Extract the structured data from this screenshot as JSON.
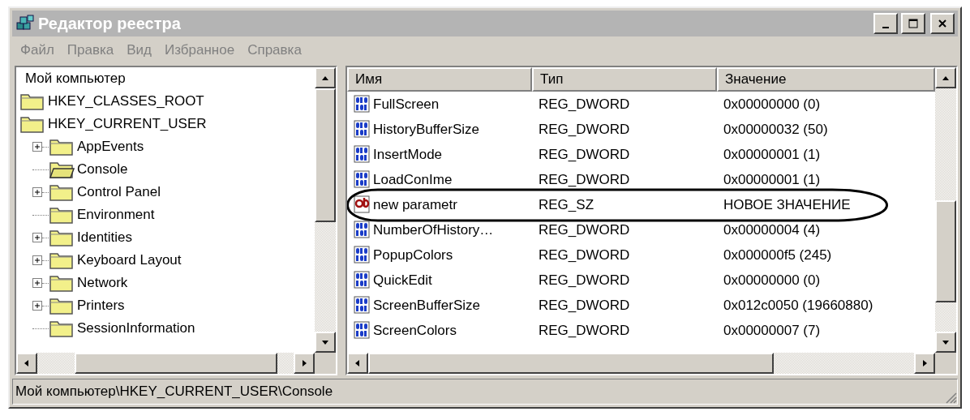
{
  "window": {
    "title": "Редактор реестра"
  },
  "menu": [
    "Файл",
    "Правка",
    "Вид",
    "Избранное",
    "Справка"
  ],
  "tree": {
    "label": "Мой компьютер",
    "selected": false,
    "children": [
      {
        "label": "HKEY_CLASSES_ROOT",
        "selected": false
      },
      {
        "label": "HKEY_CURRENT_USER",
        "selected": false,
        "children": [
          {
            "label": "AppEvents",
            "expandable": true,
            "selected": false
          },
          {
            "label": "Console",
            "expandable": false,
            "selected": true
          },
          {
            "label": "Control Panel",
            "expandable": true,
            "selected": false
          },
          {
            "label": "Environment",
            "expandable": false,
            "selected": false
          },
          {
            "label": "Identities",
            "expandable": true,
            "selected": false
          },
          {
            "label": "Keyboard Layout",
            "expandable": true,
            "selected": false
          },
          {
            "label": "Network",
            "expandable": true,
            "selected": false
          },
          {
            "label": "Printers",
            "expandable": true,
            "selected": false
          },
          {
            "label": "SessionInformation",
            "expandable": false,
            "selected": false
          }
        ]
      }
    ]
  },
  "list": {
    "columns": [
      "Имя",
      "Тип",
      "Значение"
    ],
    "rows": [
      {
        "kind": "dword",
        "name": "FullScreen",
        "type": "REG_DWORD",
        "value": "0x00000000 (0)",
        "circled": false
      },
      {
        "kind": "dword",
        "name": "HistoryBufferSize",
        "type": "REG_DWORD",
        "value": "0x00000032 (50)",
        "circled": false
      },
      {
        "kind": "dword",
        "name": "InsertMode",
        "type": "REG_DWORD",
        "value": "0x00000001 (1)",
        "circled": false
      },
      {
        "kind": "dword",
        "name": "LoadConIme",
        "type": "REG_DWORD",
        "value": "0x00000001 (1)",
        "circled": false
      },
      {
        "kind": "string",
        "name": "new parametr",
        "type": "REG_SZ",
        "value": "НОВОЕ ЗНАЧЕНИЕ",
        "circled": true
      },
      {
        "kind": "dword",
        "name": "NumberOfHistory…",
        "type": "REG_DWORD",
        "value": "0x00000004 (4)",
        "circled": false
      },
      {
        "kind": "dword",
        "name": "PopupColors",
        "type": "REG_DWORD",
        "value": "0x000000f5 (245)",
        "circled": false
      },
      {
        "kind": "dword",
        "name": "QuickEdit",
        "type": "REG_DWORD",
        "value": "0x00000000 (0)",
        "circled": false
      },
      {
        "kind": "dword",
        "name": "ScreenBufferSize",
        "type": "REG_DWORD",
        "value": "0x012c0050 (19660880)",
        "circled": false
      },
      {
        "kind": "dword",
        "name": "ScreenColors",
        "type": "REG_DWORD",
        "value": "0x00000007 (7)",
        "circled": false
      }
    ]
  },
  "status_bar": "Мой компьютер\\HKEY_CURRENT_USER\\Console"
}
